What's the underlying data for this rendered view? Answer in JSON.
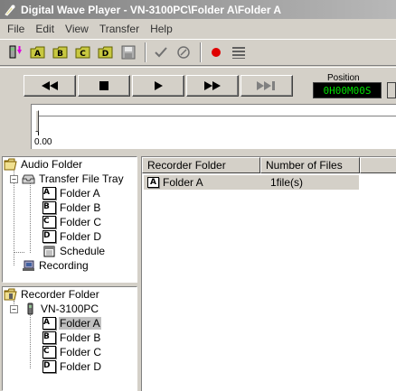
{
  "window": {
    "title": "Digital Wave Player - VN-3100PC\\Folder A\\Folder A"
  },
  "menu": [
    "File",
    "Edit",
    "View",
    "Transfer",
    "Help"
  ],
  "toolbar": {
    "buttons": [
      "transfer-tray-icon",
      "folder-a-icon",
      "folder-b-icon",
      "folder-c-icon",
      "folder-d-icon",
      "save-icon",
      "checkmark-icon",
      "cancel-icon",
      "record-icon",
      "list-icon"
    ]
  },
  "transport": {
    "position_label": "Position",
    "position_value": "0H00M00S",
    "time_start": "0.00"
  },
  "audio_tree": {
    "root": "Audio Folder",
    "transfer_tray": "Transfer File Tray",
    "folders": [
      {
        "badge": "A",
        "label": "Folder A"
      },
      {
        "badge": "B",
        "label": "Folder B"
      },
      {
        "badge": "C",
        "label": "Folder C"
      },
      {
        "badge": "D",
        "label": "Folder D"
      }
    ],
    "schedule": "Schedule",
    "recording": "Recording"
  },
  "recorder_tree": {
    "root": "Recorder Folder",
    "device": "VN-3100PC",
    "folders": [
      {
        "badge": "A",
        "label": "Folder A",
        "selected": true
      },
      {
        "badge": "B",
        "label": "Folder B"
      },
      {
        "badge": "C",
        "label": "Folder C"
      },
      {
        "badge": "D",
        "label": "Folder D"
      }
    ]
  },
  "list": {
    "columns": [
      "Recorder Folder",
      "Number of Files"
    ],
    "rows": [
      {
        "folder": "Folder A",
        "badge": "A",
        "files": "1file(s)"
      }
    ]
  },
  "colors": {
    "position_text": "#00e000",
    "record_red": "#e00000",
    "selection": "#c0c0c0"
  }
}
